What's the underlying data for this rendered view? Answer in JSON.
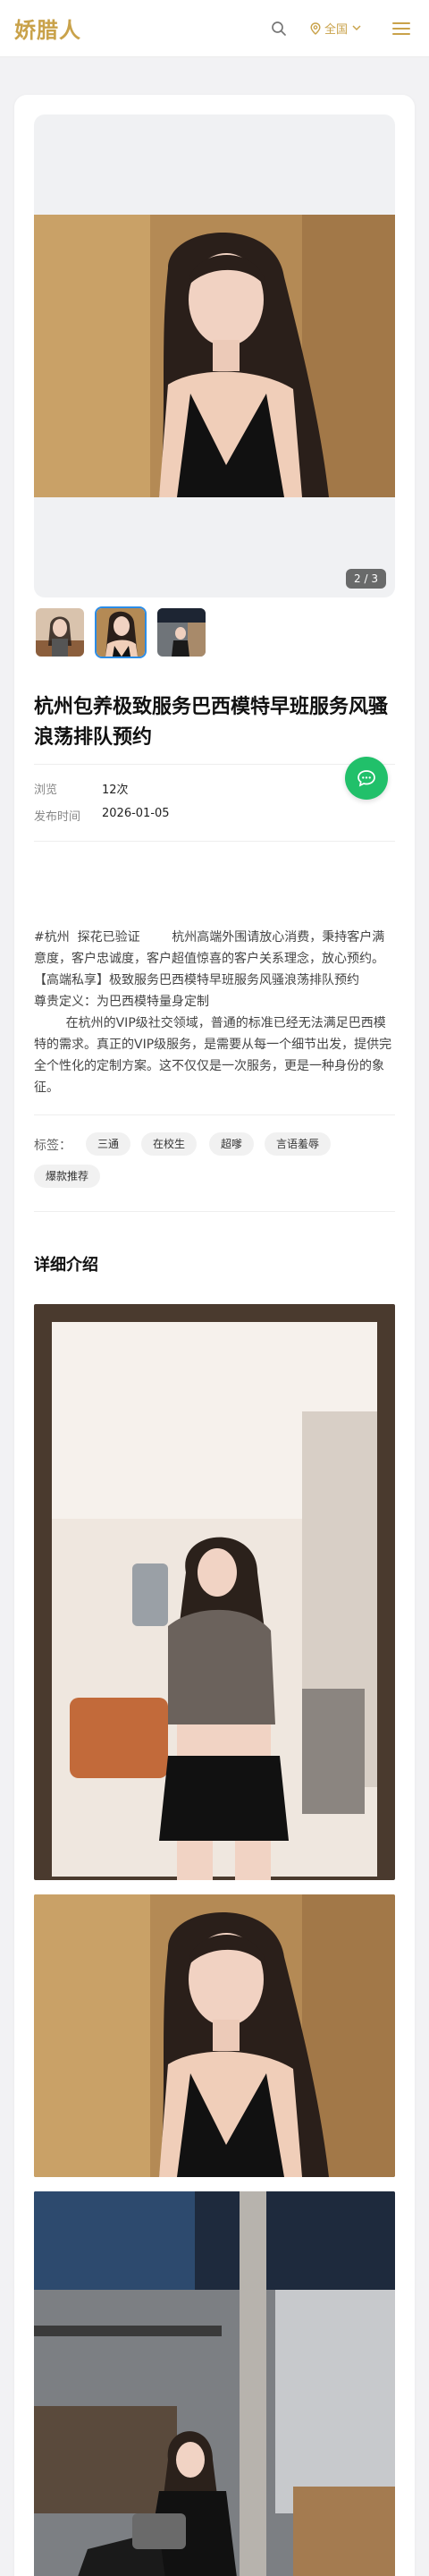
{
  "header": {
    "logo": "娇腊人",
    "region": "全国",
    "icons": [
      "search-icon",
      "map-pin-icon",
      "chevron-down-icon",
      "menu-icon"
    ]
  },
  "colors": {
    "brand": "#c9a24a",
    "accent_blue": "#2b8ce6",
    "chat_green": "#21c06a"
  },
  "gallery": {
    "counter": "2 / 3",
    "current_index": 2,
    "total": 3
  },
  "post": {
    "title": "杭州包养极致服务巴西模特早班服务风骚浪荡排队预约",
    "meta": [
      {
        "label": "浏览",
        "value": "12次"
      },
      {
        "label": "发布时间",
        "value": "2026-01-05"
      }
    ],
    "description": "#杭州  探花已验证        杭州高端外围请放心消费，秉持客户满意度，客户忠诚度，客户超值惊喜的客户关系理念，放心预约。        【高端私享】极致服务巴西模特早班服务风骚浪荡排队预约         尊贵定义：为巴西模特量身定制\n        在杭州的VIP级社交领域，普通的标准已经无法满足巴西模特的需求。真正的VIP级服务，是需要从每一个细节出发，提供完全个性化的定制方案。这不仅仅是一次服务，更是一种身份的象征。",
    "tags_label": "标签：",
    "tags": [
      "三通",
      "在校生",
      "超嗲",
      "言语羞辱",
      "爆款推荐"
    ]
  },
  "details": {
    "section_title": "详细介绍"
  }
}
